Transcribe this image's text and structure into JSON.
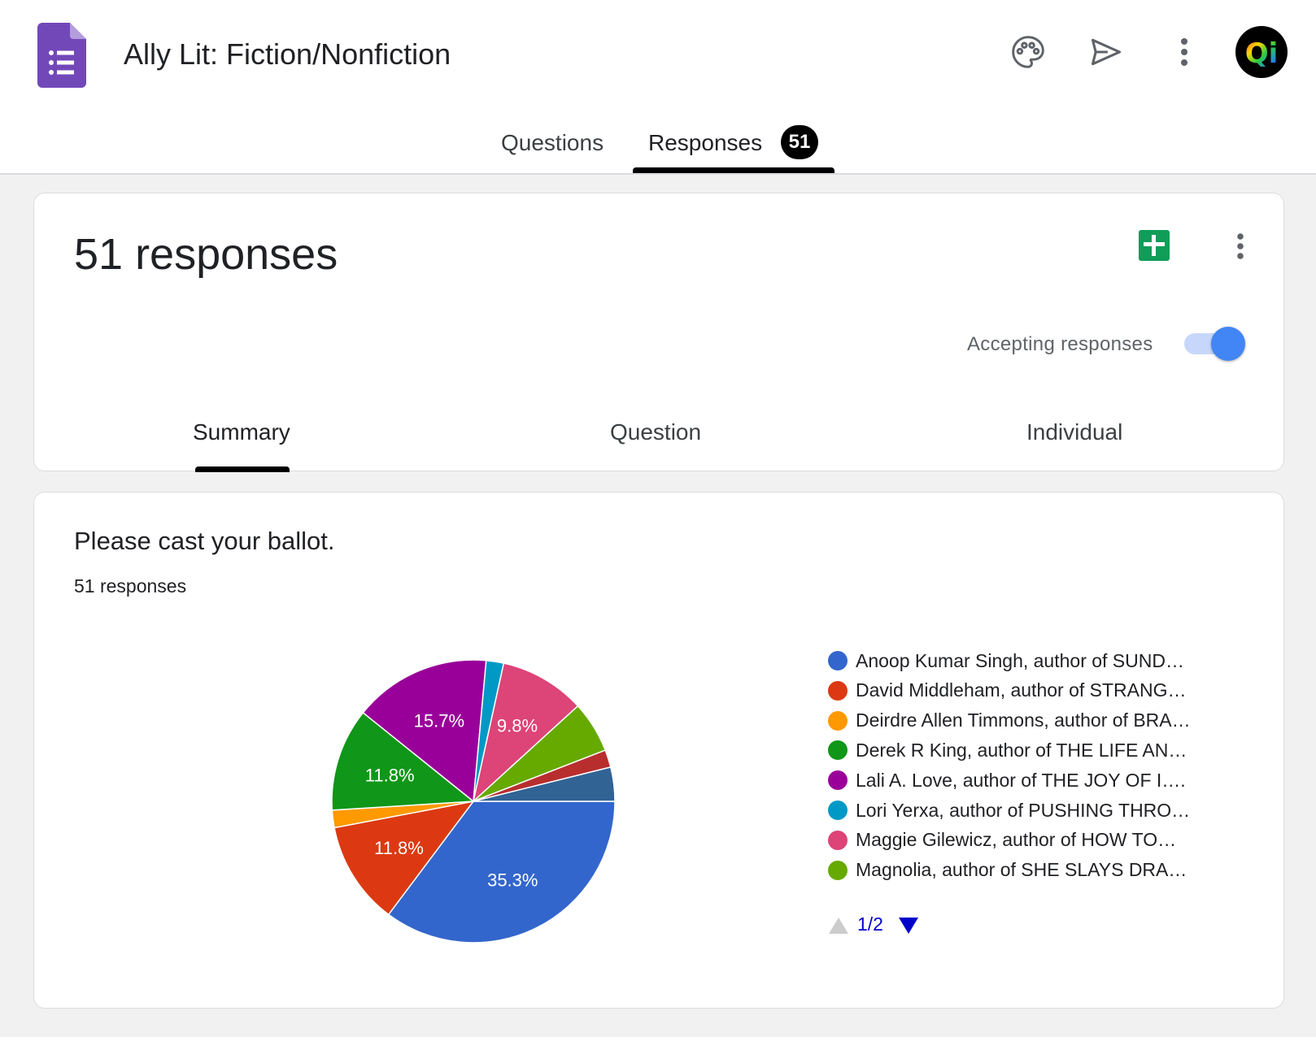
{
  "header": {
    "title": "Ally Lit: Fiction/Nonfiction",
    "icons": [
      "palette-icon",
      "send-icon",
      "more-vert-icon"
    ],
    "avatar_text": "Qi"
  },
  "tabs": {
    "questions": "Questions",
    "responses": "Responses",
    "responses_count": "51"
  },
  "summary_card": {
    "heading": "51 responses",
    "accepting_label": "Accepting responses",
    "accepting": true,
    "sub_tabs": [
      "Summary",
      "Question",
      "Individual"
    ],
    "active_sub_tab": "Summary"
  },
  "question_card": {
    "title": "Please cast your ballot.",
    "response_count": "51 responses"
  },
  "chart_data": {
    "type": "pie",
    "title": "",
    "slices": [
      {
        "label": "Anoop Kumar Singh, author of SUND…",
        "value": 35.3,
        "color": "#3366cc",
        "data_label": "35.3%"
      },
      {
        "label": "David Middleham, author of STRANG…",
        "value": 11.8,
        "color": "#dc3912",
        "data_label": "11.8%"
      },
      {
        "label": "Deirdre Allen Timmons, author of BRA…",
        "value": 2.0,
        "color": "#ff9900",
        "data_label": ""
      },
      {
        "label": "Derek R King, author of THE LIFE AN…",
        "value": 11.8,
        "color": "#109618",
        "data_label": "11.8%"
      },
      {
        "label": "Lali A. Love, author of THE JOY OF I….",
        "value": 15.7,
        "color": "#990099",
        "data_label": "15.7%"
      },
      {
        "label": "Lori Yerxa, author of PUSHING THRO…",
        "value": 2.0,
        "color": "#0099c6",
        "data_label": ""
      },
      {
        "label": "Maggie Gilewicz, author of HOW TO…",
        "value": 9.8,
        "color": "#dd4477",
        "data_label": "9.8%"
      },
      {
        "label": "Magnolia, author of SHE SLAYS DRA…",
        "value": 5.9,
        "color": "#66aa00",
        "data_label": ""
      },
      {
        "label": "",
        "value": 2.0,
        "color": "#b82e2e",
        "data_label": ""
      },
      {
        "label": "",
        "value": 3.9,
        "color": "#316395",
        "data_label": ""
      }
    ],
    "legend_page": "1/2",
    "legend_placement": "right"
  }
}
